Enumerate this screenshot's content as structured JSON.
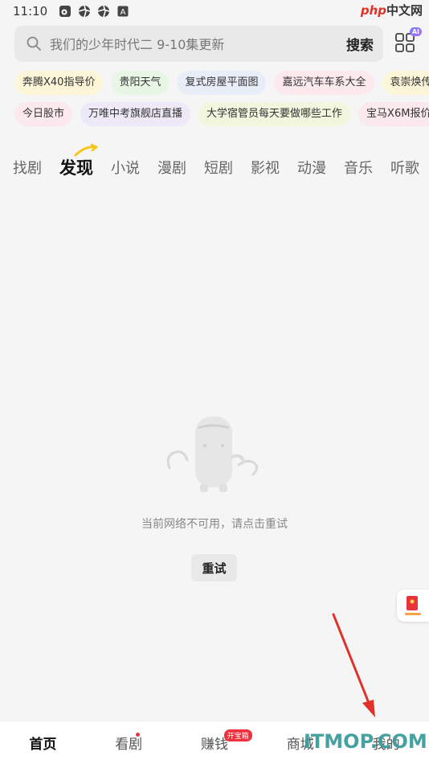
{
  "status_bar": {
    "time": "11:10",
    "icons": [
      "weibo-icon",
      "aperture-icon",
      "aperture-icon",
      "text-a-icon"
    ],
    "watermark_brand": "php",
    "watermark_suffix": "中文网"
  },
  "search": {
    "placeholder": "我们的少年时代二 9-10集更新",
    "button_label": "搜索",
    "ai_badge": "AI"
  },
  "hot_tags": {
    "row1": [
      "奔腾X40指导价",
      "贵阳天气",
      "复式房屋平面图",
      "嘉远汽车车系大全",
      "袁崇焕传"
    ],
    "row2": [
      "今日股市",
      "万唯中考旗舰店直播",
      "大学宿管员每天要做哪些工作",
      "宝马X6M报价"
    ]
  },
  "category_tabs": [
    "找剧",
    "发现",
    "小说",
    "漫剧",
    "短剧",
    "影视",
    "动漫",
    "音乐",
    "听歌"
  ],
  "empty_state": {
    "message": "当前网络不可用，请点击重试",
    "retry_label": "重试"
  },
  "bottom_nav": {
    "items": [
      "首页",
      "看剧",
      "赚钱",
      "商城",
      "我的"
    ],
    "earn_badge": "开宝箱"
  },
  "watermark_bottom": "ITMOP.COM",
  "colors": {
    "accent_red": "#f0303c",
    "annotation_red": "#e0322a",
    "swoosh_yellow": "#f5c518"
  }
}
